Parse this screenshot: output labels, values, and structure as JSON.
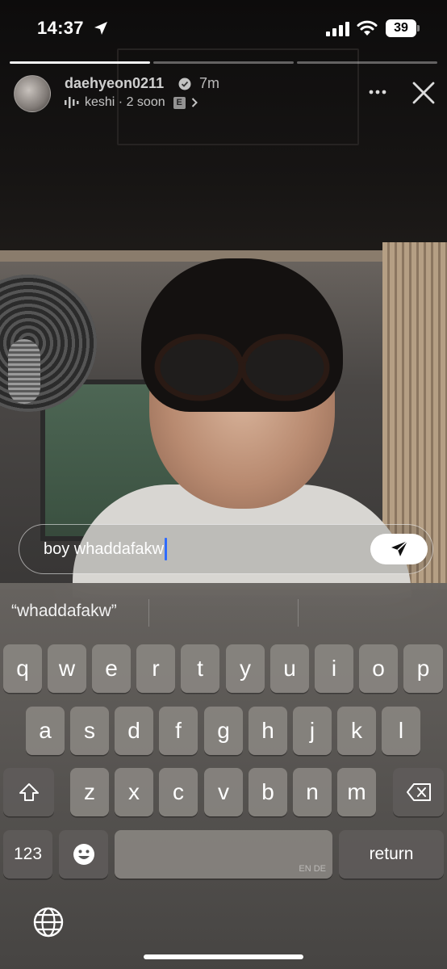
{
  "status_bar": {
    "time": "14:37",
    "battery": "39"
  },
  "story": {
    "username": "daehyeon0211",
    "age": "7m",
    "music": "keshi · 2 soon",
    "explicit": "E",
    "segments_total": 3,
    "segment_current": 1
  },
  "reply": {
    "text": "boy whaddafakw"
  },
  "keyboard": {
    "suggestions": [
      "“whaddafakw”",
      "",
      ""
    ],
    "row1": [
      "q",
      "w",
      "e",
      "r",
      "t",
      "y",
      "u",
      "i",
      "o",
      "p"
    ],
    "row2": [
      "a",
      "s",
      "d",
      "f",
      "g",
      "h",
      "j",
      "k",
      "l"
    ],
    "row3": [
      "z",
      "x",
      "c",
      "v",
      "b",
      "n",
      "m"
    ],
    "numbers_label": "123",
    "space_lang": "EN DE",
    "return_label": "return"
  },
  "colors": {
    "caret": "#2f6bff",
    "send_button": "#ffffff"
  }
}
